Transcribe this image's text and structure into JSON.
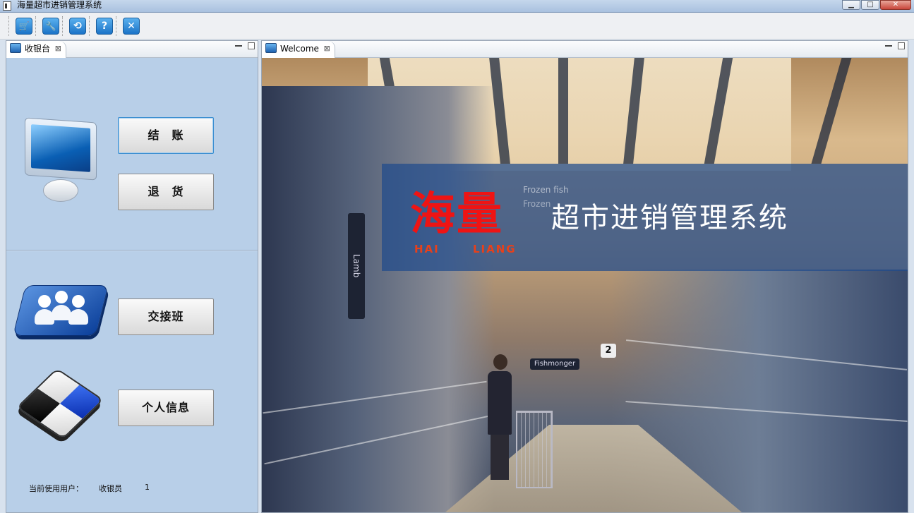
{
  "window": {
    "title": "海量超市进销管理系统",
    "buttons": [
      "▁",
      "□",
      "✕"
    ]
  },
  "toolbar": {
    "items": [
      {
        "name": "cart-icon",
        "glyph": "🛒"
      },
      {
        "name": "wrench-icon",
        "glyph": "🔧"
      },
      {
        "name": "refresh-icon",
        "glyph": "⟲"
      },
      {
        "name": "help-icon",
        "glyph": "?"
      },
      {
        "name": "close-icon",
        "glyph": "✕"
      }
    ]
  },
  "left_panel": {
    "tab_label": "收银台",
    "tab_close": "⊠",
    "buttons": {
      "checkout": "结　账",
      "return": "退　货",
      "shift": "交接班",
      "profile": "个人信息"
    },
    "status": {
      "label": "当前使用用户：",
      "role": "收银员",
      "id": "1"
    }
  },
  "right_panel": {
    "tab_label": "Welcome",
    "tab_close": "⊠",
    "banner": {
      "brand": "海量",
      "brand_sub_1": "HAI",
      "brand_sub_2": "LIANG",
      "system_title": "超市进销管理系统"
    },
    "signs": {
      "lamb": "Lamb",
      "fishmonger": "Fishmonger",
      "frozen_fish": "Frozen fish",
      "frozen": "Frozen",
      "aisle_number": "2"
    }
  },
  "colors": {
    "left_panel_bg": "#b8cfe8",
    "brand_red": "#ee1414",
    "banner_blue": "#204b8c"
  }
}
